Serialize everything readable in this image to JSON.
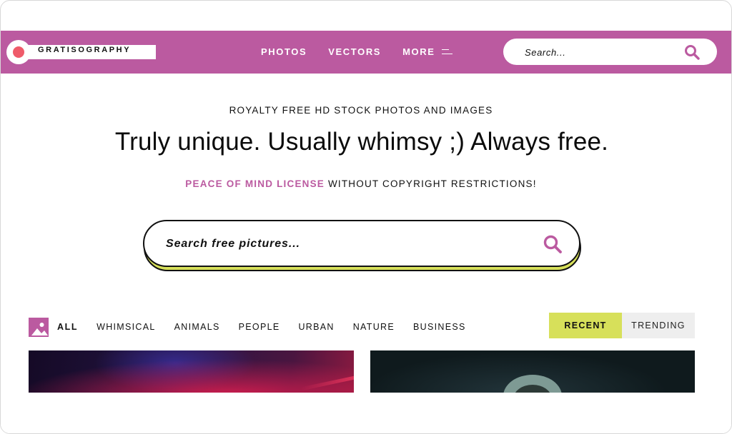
{
  "brand": {
    "name": "GRATISOGRAPHY",
    "accent_color": "#bb5aa0",
    "logo_dot_color": "#ef5b6a"
  },
  "nav": {
    "links": [
      "PHOTOS",
      "VECTORS",
      "MORE"
    ],
    "more_icon": "menu-icon",
    "search_placeholder": "Search...",
    "search_icon": "search-icon"
  },
  "hero": {
    "kicker": "ROYALTY FREE HD STOCK PHOTOS AND IMAGES",
    "title": "Truly unique. Usually whimsy ;) Always free.",
    "license_link": "PEACE OF MIND LICENSE",
    "license_rest": " WITHOUT COPYRIGHT RESTRICTIONS!",
    "search_placeholder": "Search free pictures...",
    "search_shadow_color": "#d7e05a"
  },
  "categories": {
    "icon": "image-icon",
    "items": [
      "ALL",
      "WHIMSICAL",
      "ANIMALS",
      "PEOPLE",
      "URBAN",
      "NATURE",
      "BUSINESS"
    ],
    "active": "ALL"
  },
  "sort": {
    "options": [
      "RECENT",
      "TRENDING"
    ],
    "active": "RECENT"
  }
}
